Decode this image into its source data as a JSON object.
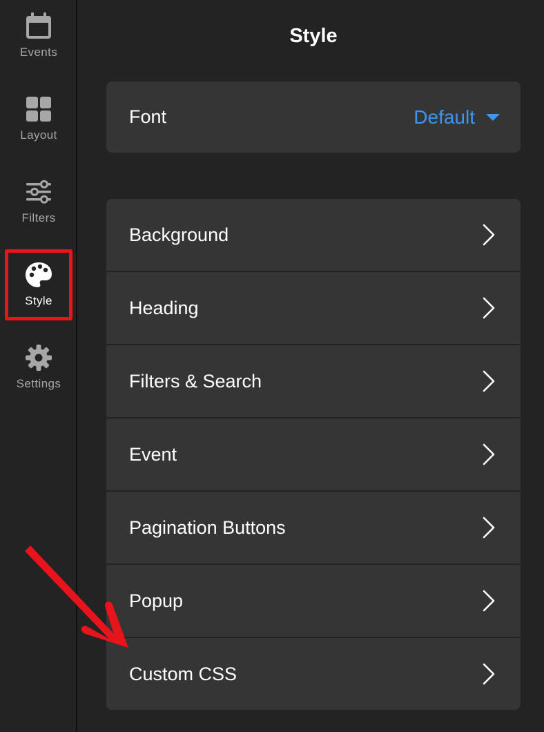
{
  "sidebar": {
    "items": [
      {
        "label": "Events",
        "icon": "calendar-icon"
      },
      {
        "label": "Layout",
        "icon": "layout-grid-icon"
      },
      {
        "label": "Filters",
        "icon": "sliders-icon"
      },
      {
        "label": "Style",
        "icon": "palette-icon",
        "active": true
      },
      {
        "label": "Settings",
        "icon": "gear-icon"
      }
    ]
  },
  "header": {
    "title": "Style"
  },
  "font": {
    "label": "Font",
    "value": "Default"
  },
  "style_options": [
    {
      "label": "Background"
    },
    {
      "label": "Heading"
    },
    {
      "label": "Filters & Search"
    },
    {
      "label": "Event"
    },
    {
      "label": "Pagination Buttons"
    },
    {
      "label": "Popup"
    },
    {
      "label": "Custom CSS"
    }
  ],
  "colors": {
    "background": "#232323",
    "card": "#353535",
    "accent": "#3d95f0",
    "highlight": "#e8141b"
  }
}
